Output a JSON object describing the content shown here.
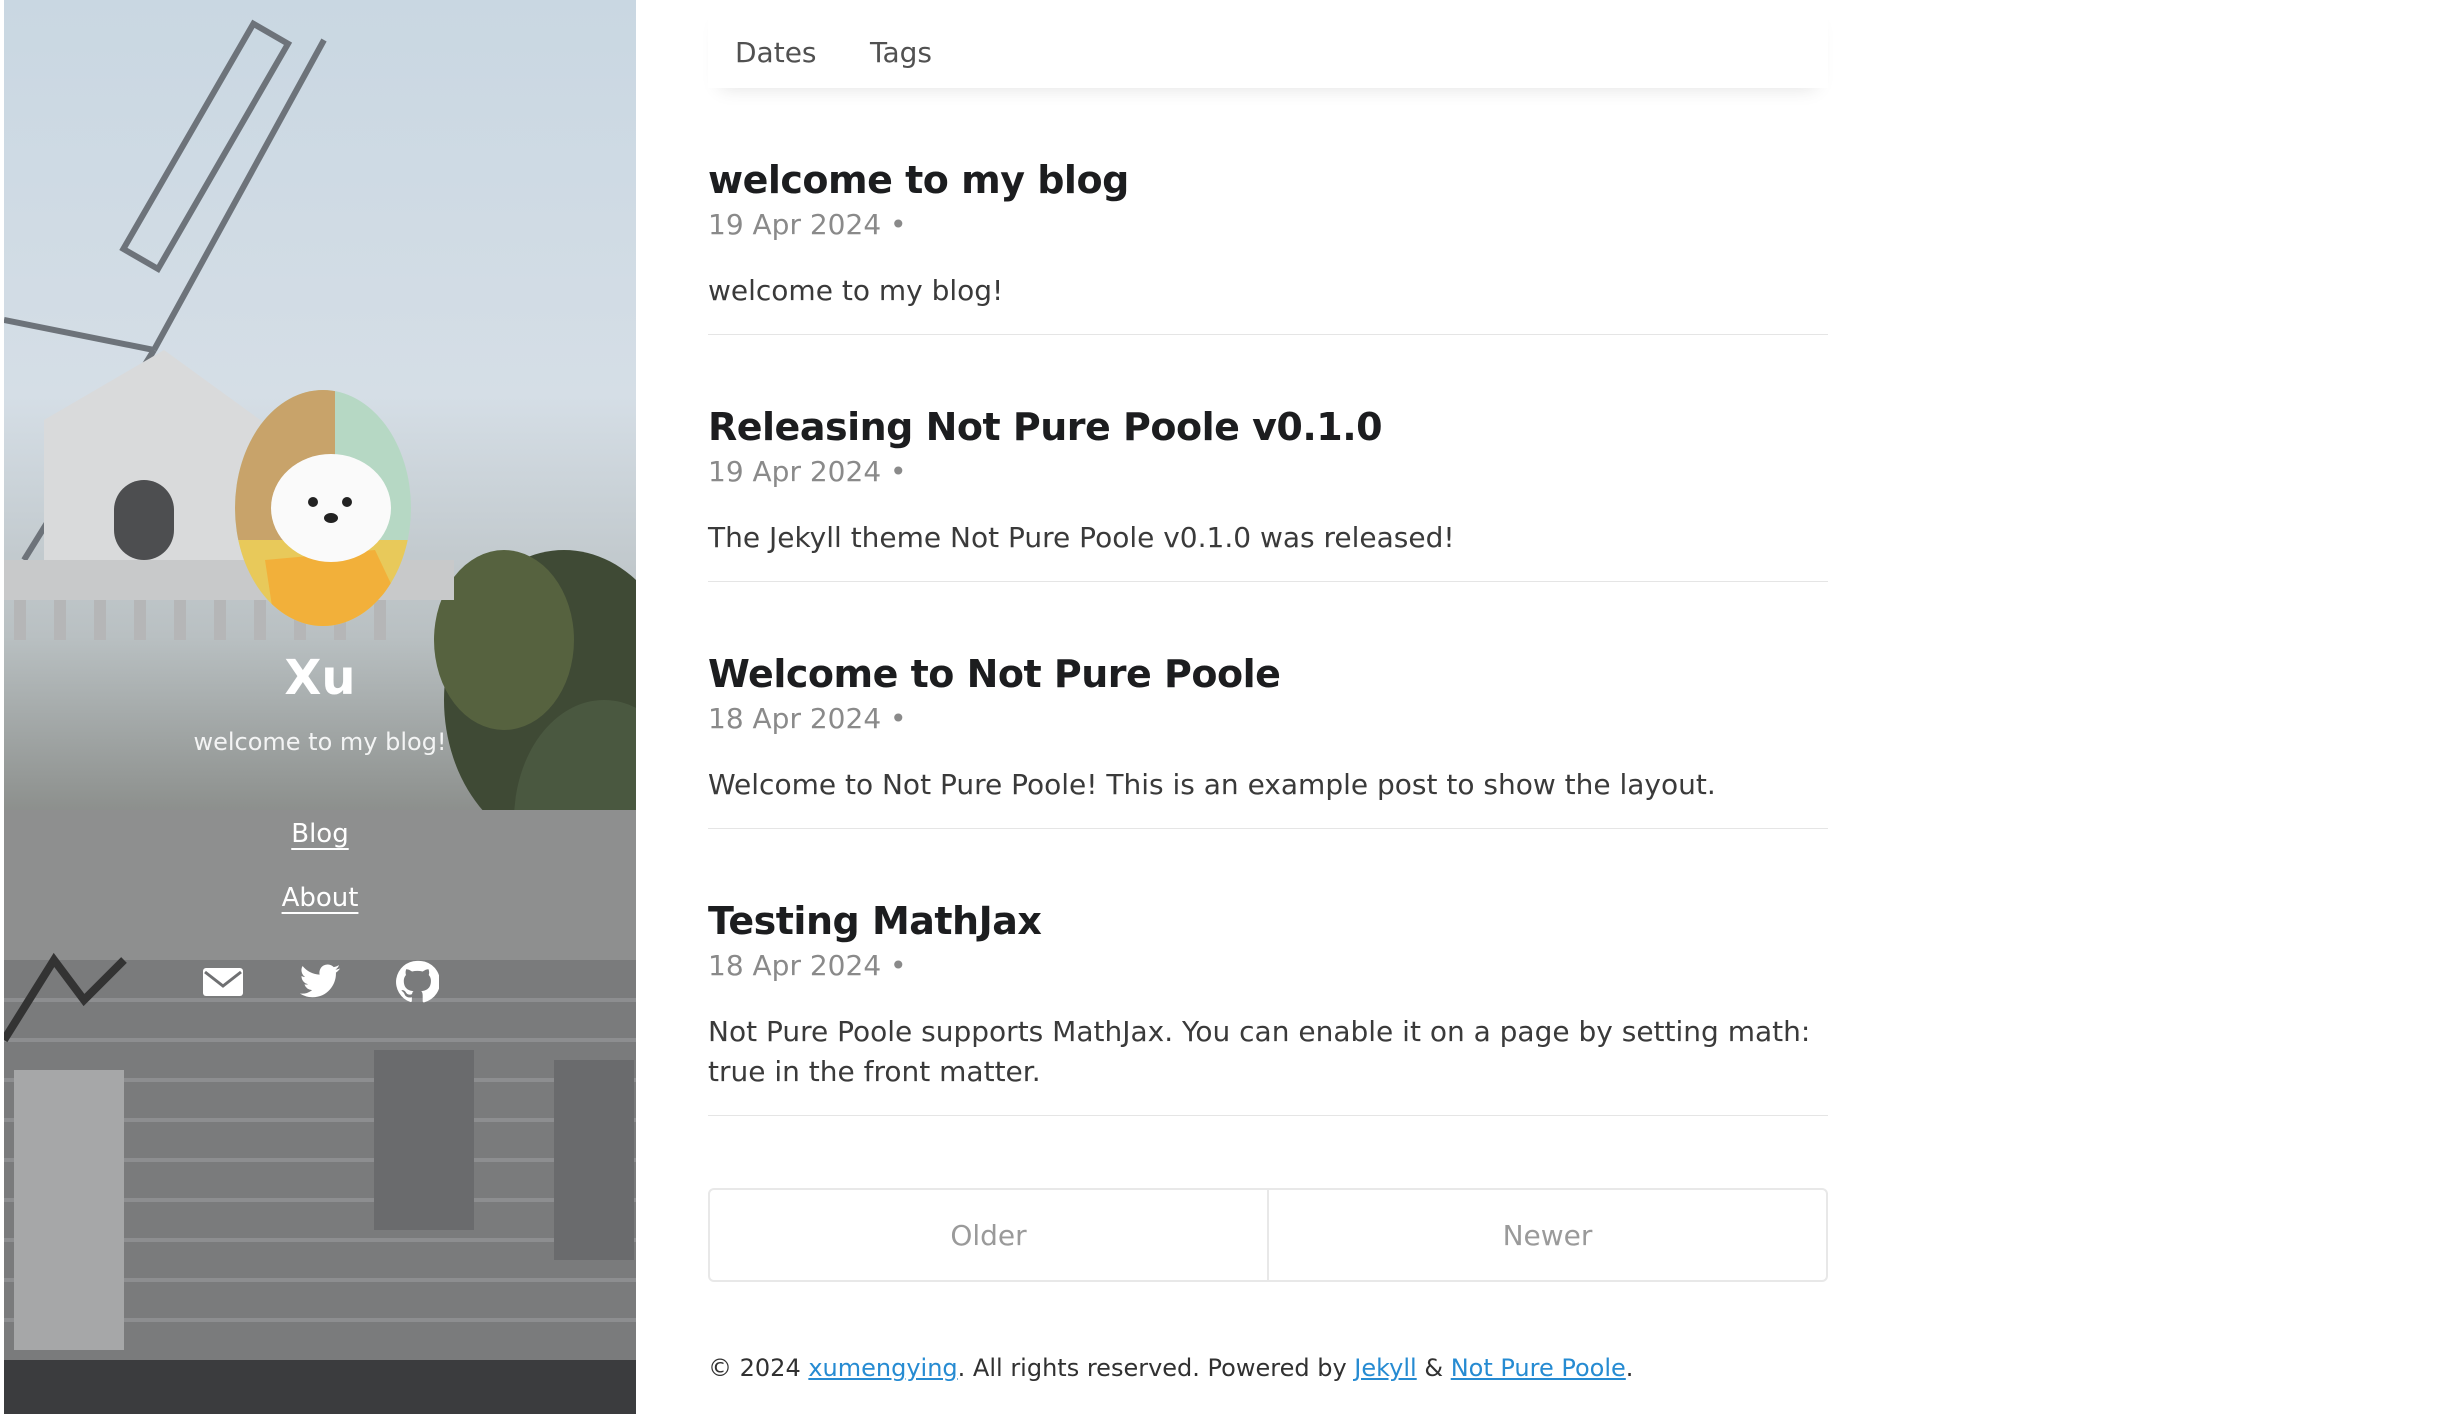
{
  "top_nav": {
    "dates": "Dates",
    "tags": "Tags"
  },
  "sidebar": {
    "title": "Xu",
    "description": "welcome to my blog!",
    "nav": [
      {
        "label": "Blog"
      },
      {
        "label": "About"
      }
    ],
    "social_icons": [
      "email-icon",
      "twitter-icon",
      "github-icon"
    ]
  },
  "posts": [
    {
      "title": "welcome to my blog",
      "date": "19 Apr 2024 •",
      "excerpt": "welcome to my blog!"
    },
    {
      "title": "Releasing Not Pure Poole v0.1.0",
      "date": "19 Apr 2024 •",
      "excerpt": "The Jekyll theme Not Pure Poole v0.1.0 was released!"
    },
    {
      "title": "Welcome to Not Pure Poole",
      "date": "18 Apr 2024 •",
      "excerpt": "Welcome to Not Pure Poole! This is an example post to show the layout."
    },
    {
      "title": "Testing MathJax",
      "date": "18 Apr 2024 •",
      "excerpt": "Not Pure Poole supports MathJax. You can enable it on a page by setting math: true in the front matter."
    }
  ],
  "pagination": {
    "older": "Older",
    "newer": "Newer"
  },
  "footer": {
    "prefix": "© 2024 ",
    "author": "xumengying",
    "middle": ". All rights reserved. Powered by ",
    "jekyll": "Jekyll",
    "amp": " & ",
    "theme": "Not Pure Poole",
    "suffix": "."
  },
  "colors": {
    "link": "#268bd2",
    "title": "#1c1d1f",
    "muted": "#8a8a8a"
  }
}
